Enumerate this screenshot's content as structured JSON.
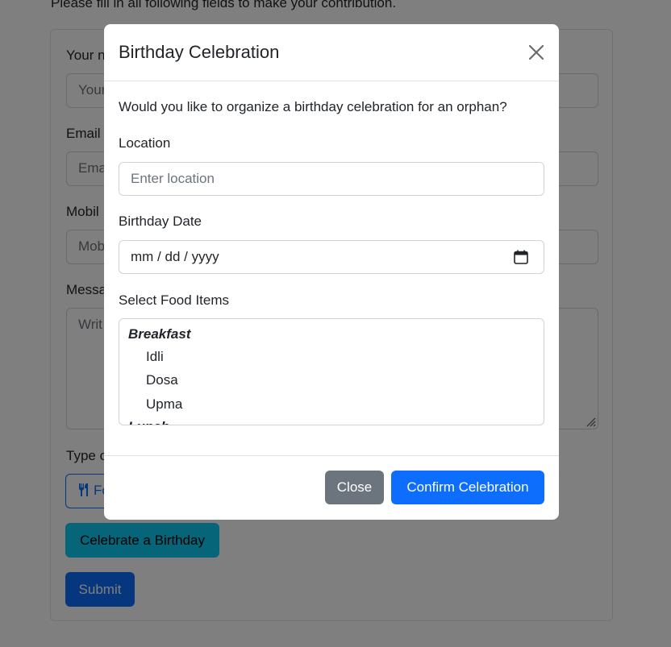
{
  "page": {
    "intro": "Please fill in all following fields to make your contribution.",
    "form": {
      "name_label": "Your n",
      "name_placeholder": "Your",
      "email_label": "Email",
      "email_placeholder": "Ema",
      "mobile_label": "Mobil",
      "mobile_placeholder": "Mob",
      "message_label": "Messa",
      "message_placeholder": "Writ",
      "type_label": "Type o",
      "food_button_label": "Fo",
      "celebrate_button": "Celebrate a Birthday",
      "submit_button": "Submit"
    }
  },
  "modal": {
    "title": "Birthday Celebration",
    "question": "Would you like to organize a birthday celebration for an orphan?",
    "location_label": "Location",
    "location_placeholder": "Enter location",
    "date_label": "Birthday Date",
    "date_value": "mm / dd / yyyy",
    "food_label": "Select Food Items",
    "food_groups": [
      {
        "label": "Breakfast",
        "items": [
          "Idli",
          "Dosa",
          "Upma"
        ]
      },
      {
        "label": "Lunch",
        "items": []
      }
    ],
    "close_button": "Close",
    "confirm_button": "Confirm Celebration"
  },
  "colors": {
    "primary": "#0d6efd",
    "info": "#0dcaf0",
    "secondary": "#6c757d",
    "backdrop": "rgba(0,0,0,0.5)"
  },
  "icons": [
    "close-icon",
    "calendar-icon",
    "utensils-icon",
    "resize-grip-icon"
  ]
}
